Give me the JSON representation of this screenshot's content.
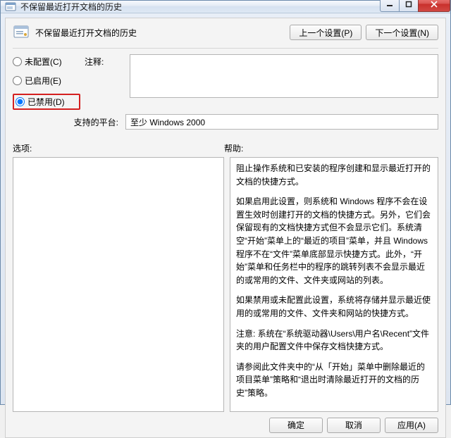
{
  "window": {
    "title": "不保留最近打开文档的历史"
  },
  "header": {
    "title": "不保留最近打开文档的历史",
    "prev_btn": "上一个设置(P)",
    "next_btn": "下一个设置(N)"
  },
  "radios": {
    "not_configured": "未配置(C)",
    "enabled": "已启用(E)",
    "disabled": "已禁用(D)",
    "selected": "disabled"
  },
  "comment": {
    "label": "注释:",
    "value": ""
  },
  "platform": {
    "label": "支持的平台:",
    "value": "至少 Windows 2000"
  },
  "panels": {
    "options_label": "选项:",
    "help_label": "帮助:",
    "options_text": "",
    "help_paragraphs": [
      "阻止操作系统和已安装的程序创建和显示最近打开的文档的快捷方式。",
      "如果启用此设置，则系统和 Windows 程序不会在设置生效时创建打开的文档的快捷方式。另外，它们会保留现有的文档快捷方式但不会显示它们。系统清空“开始”菜单上的“最近的项目”菜单，并且 Windows 程序不在“文件”菜单底部显示快捷方式。此外，“开始”菜单和任务栏中的程序的跳转列表不会显示最近的或常用的文件、文件夹或网站的列表。",
      "如果禁用或未配置此设置，系统将存储并显示最近使用的或常用的文件、文件夹和网站的快捷方式。",
      "注意: 系统在“系统驱动器\\Users\\用户名\\Recent”文件夹的用户配置文件中保存文档快捷方式。",
      "请参阅此文件夹中的“从「开始」菜单中删除最近的项目菜单”策略和“退出时清除最近打开的文档的历史”策略。"
    ]
  },
  "footer": {
    "ok": "确定",
    "cancel": "取消",
    "apply": "应用(A)"
  }
}
